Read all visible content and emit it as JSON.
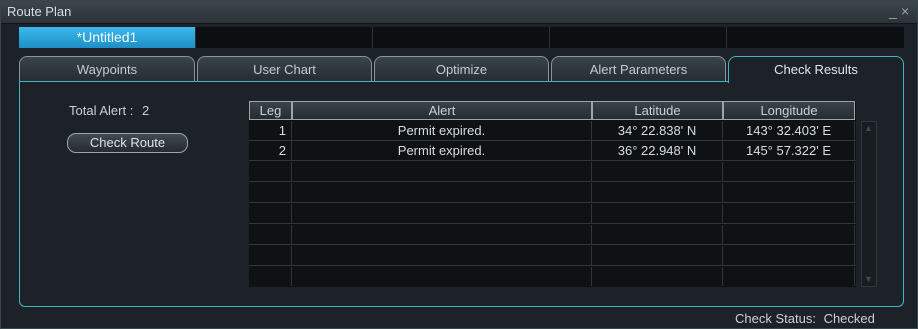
{
  "window": {
    "title": "Route Plan",
    "minimize": "_",
    "close": "×"
  },
  "file_tabs": [
    {
      "label": "*Untitled1",
      "active": true
    },
    {
      "label": "",
      "active": false
    },
    {
      "label": "",
      "active": false
    },
    {
      "label": "",
      "active": false
    },
    {
      "label": "",
      "active": false
    }
  ],
  "tabs": [
    {
      "label": "Waypoints",
      "active": false
    },
    {
      "label": "User Chart",
      "active": false
    },
    {
      "label": "Optimize",
      "active": false
    },
    {
      "label": "Alert Parameters",
      "active": false
    },
    {
      "label": "Check Results",
      "active": true
    }
  ],
  "check_results": {
    "total_alert_label": "Total Alert :",
    "total_alert_value": "2",
    "check_route_button": "Check Route",
    "columns": [
      "Leg",
      "Alert",
      "Latitude",
      "Longitude"
    ],
    "rows": [
      {
        "leg": "1",
        "alert": "Permit expired.",
        "latitude": "34° 22.838' N",
        "longitude": "143° 32.403' E"
      },
      {
        "leg": "2",
        "alert": "Permit expired.",
        "latitude": "36° 22.948' N",
        "longitude": "145° 57.322' E"
      },
      {
        "leg": "",
        "alert": "",
        "latitude": "",
        "longitude": ""
      },
      {
        "leg": "",
        "alert": "",
        "latitude": "",
        "longitude": ""
      },
      {
        "leg": "",
        "alert": "",
        "latitude": "",
        "longitude": ""
      },
      {
        "leg": "",
        "alert": "",
        "latitude": "",
        "longitude": ""
      },
      {
        "leg": "",
        "alert": "",
        "latitude": "",
        "longitude": ""
      },
      {
        "leg": "",
        "alert": "",
        "latitude": "",
        "longitude": ""
      }
    ]
  },
  "status": {
    "label": "Check Status:",
    "value": "Checked"
  },
  "colors": {
    "accent": "#3fb6c8",
    "active_file_tab": "#2aa3dc",
    "background": "#1c2227"
  },
  "icons": {
    "scroll_up": "triangle-up-icon",
    "scroll_down": "triangle-down-icon"
  }
}
